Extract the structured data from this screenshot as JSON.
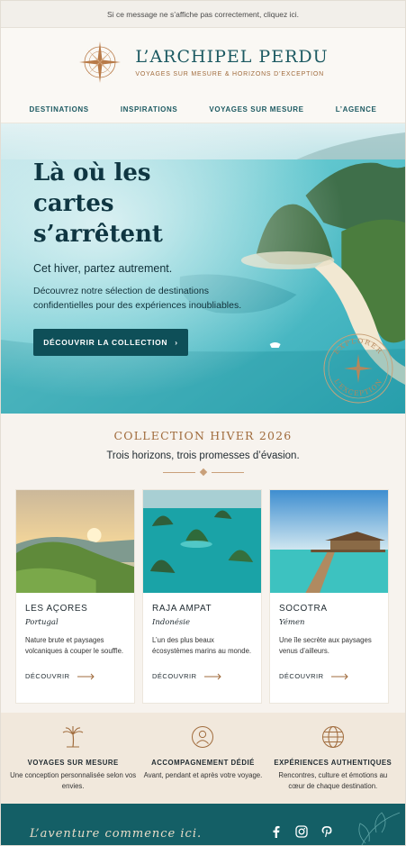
{
  "topbar": {
    "text": "Si ce message ne s’affiche pas correctement, cliquez ici."
  },
  "brand": {
    "name": "L’ARCHIPEL PERDU",
    "tagline": "VOYAGES SUR MESURE & HORIZONS D’EXCEPTION"
  },
  "nav": {
    "items": [
      {
        "label": "DESTINATIONS"
      },
      {
        "label": "INSPIRATIONS"
      },
      {
        "label": "VOYAGES SUR MESURE"
      },
      {
        "label": "L’AGENCE"
      }
    ]
  },
  "hero": {
    "title_line1": "Là où les",
    "title_line2": "cartes s’arrêtent",
    "subtitle": "Cet hiver, partez autrement.",
    "description": "Découvrez notre sélection de destinations confidentielles pour des expériences inoubliables.",
    "cta": "DÉCOUVRIR LA COLLECTION",
    "cta_arrow": "›",
    "stamp_text_top": "EXPLORER",
    "stamp_text_bottom": "L’EXCEPTION"
  },
  "collection": {
    "label": "COLLECTION HIVER 2026",
    "subtitle": "Trois horizons, trois promesses d’évasion."
  },
  "cards": [
    {
      "title": "LES AÇORES",
      "country": "Portugal",
      "description": "Nature brute et paysages volcaniques à couper le souffle.",
      "link": "DÉCOUVRIR"
    },
    {
      "title": "RAJA AMPAT",
      "country": "Indonésie",
      "description": "L’un des plus beaux écosystèmes marins au monde.",
      "link": "DÉCOUVRIR"
    },
    {
      "title": "SOCOTRA",
      "country": "Yémen",
      "description": "Une île secrète aux paysages venus d’ailleurs.",
      "link": "DÉCOUVRIR"
    }
  ],
  "features": [
    {
      "icon": "palm-tree-icon",
      "title": "VOYAGES SUR MESURE",
      "description": "Une conception personnalisée selon vos envies."
    },
    {
      "icon": "person-icon",
      "title": "ACCOMPAGNEMENT DÉDIÉ",
      "description": "Avant, pendant et après votre voyage."
    },
    {
      "icon": "globe-icon",
      "title": "EXPÉRIENCES AUTHENTIQUES",
      "description": "Rencontres, culture et émotions au cœur de chaque destination."
    }
  ],
  "footer": {
    "tagline": "L’aventure commence ici.",
    "socials": [
      "facebook-icon",
      "instagram-icon",
      "pinterest-icon"
    ]
  },
  "colors": {
    "teal": "#0e4f58",
    "copper": "#a06b3c",
    "sand": "#f1e8dc",
    "footer": "#145f66"
  }
}
